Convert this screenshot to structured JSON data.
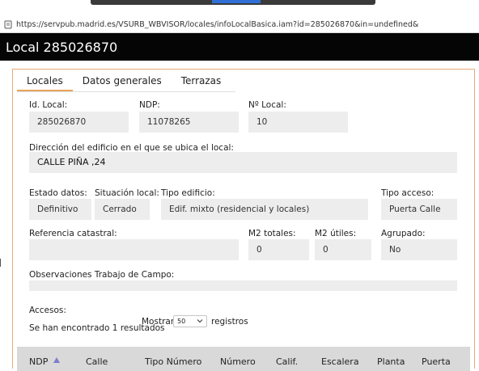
{
  "browser": {
    "url": "https://servpub.madrid.es/VSURB_WBVISOR/locales/infoLocalBasica.iam?id=285026870&in=undefined&"
  },
  "page": {
    "title": "Local 285026870"
  },
  "tabs": [
    {
      "label": "Locales",
      "active": true
    },
    {
      "label": "Datos generales",
      "active": false
    },
    {
      "label": "Terrazas",
      "active": false
    }
  ],
  "fields": {
    "id_local": {
      "label": "Id. Local:",
      "value": "285026870"
    },
    "ndp": {
      "label": "NDP:",
      "value": "11078265"
    },
    "n_local": {
      "label": "Nº Local:",
      "value": "10"
    },
    "direccion": {
      "label": "Dirección del edificio en el que se ubica el local:",
      "value": "CALLE PIÑA ,24"
    },
    "estado_datos": {
      "label": "Estado datos:",
      "value": "Definitivo"
    },
    "situacion_local": {
      "label": "Situación local:",
      "value": "Cerrado"
    },
    "tipo_edificio": {
      "label": "Tipo edificio:",
      "value": "Edif. mixto (residencial y locales)"
    },
    "tipo_acceso": {
      "label": "Tipo acceso:",
      "value": "Puerta Calle"
    },
    "referencia_catastral": {
      "label": "Referencia catastral:",
      "value": ""
    },
    "m2_totales": {
      "label": "M2 totales:",
      "value": "0"
    },
    "m2_utiles": {
      "label": "M2 útiles:",
      "value": "0"
    },
    "agrupado": {
      "label": "Agrupado:",
      "value": "No"
    },
    "observaciones": {
      "label": "Observaciones Trabajo de Campo:",
      "value": ""
    }
  },
  "accesos": {
    "heading": "Accesos:",
    "results_text": "Se han encontrado 1 resultados",
    "show_label": "Mostrar",
    "page_size": "50",
    "records_label": "registros",
    "columns": [
      "NDP",
      "Calle",
      "Tipo Número",
      "Número",
      "Calif.",
      "Escalera",
      "Planta",
      "Puerta"
    ]
  },
  "colors": {
    "title_bar": "#050505",
    "tab_underline": "#e8a35c",
    "panel_border": "#e8a97a",
    "field_bg": "#ededed",
    "table_header_bg": "#d9d9d9"
  },
  "icons": {
    "url": "page-icon",
    "sort": "sort-asc-icon",
    "dropdown": "chevron-down-icon"
  }
}
